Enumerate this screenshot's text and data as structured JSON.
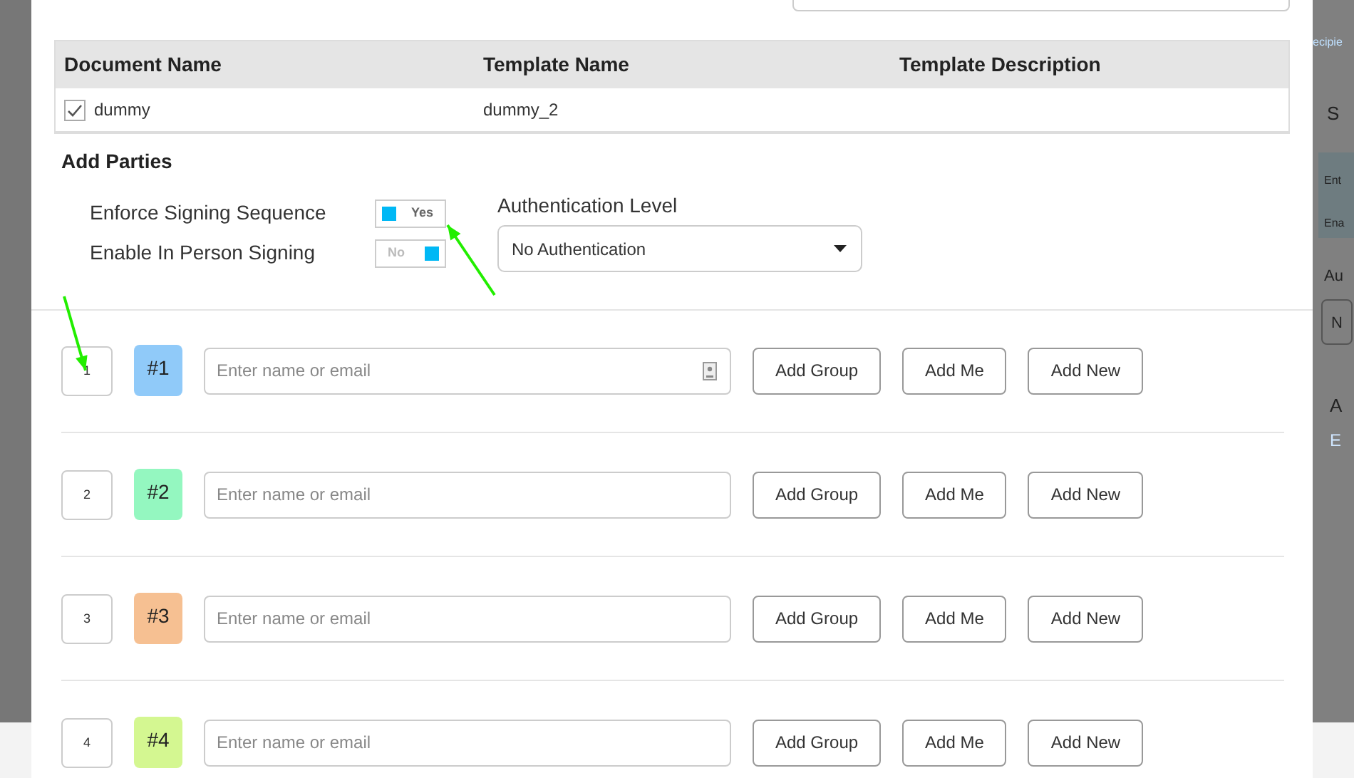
{
  "documents_table": {
    "columns": [
      "Document Name",
      "Template Name",
      "Template Description"
    ],
    "rows": [
      {
        "checked": true,
        "cells": [
          "dummy",
          "dummy_2",
          null
        ]
      }
    ]
  },
  "add_parties": {
    "title": "Add Parties",
    "toggles": [
      {
        "label": "Enforce Signing Sequence",
        "on": true,
        "text": "Yes"
      },
      {
        "label": "Enable In Person Signing",
        "on": false,
        "text": "No"
      }
    ],
    "authentication": {
      "label": "Authentication Level",
      "value": "No Authentication"
    }
  },
  "parties": [
    {
      "order": "1",
      "tag": "#1",
      "color": "#90caf9",
      "placeholder": "Enter name or email",
      "contact_icon": true,
      "buttons": [
        "Add Group",
        "Add Me",
        "Add New"
      ]
    },
    {
      "order": "2",
      "tag": "#2",
      "color": "#94f7c0",
      "placeholder": "Enter name or email",
      "contact_icon": false,
      "buttons": [
        "Add Group",
        "Add Me",
        "Add New"
      ]
    },
    {
      "order": "3",
      "tag": "#3",
      "color": "#f6c092",
      "placeholder": "Enter name or email",
      "contact_icon": false,
      "buttons": [
        "Add Group",
        "Add Me",
        "Add New"
      ]
    },
    {
      "order": "4",
      "tag": "#4",
      "color": "#d4f791",
      "placeholder": "Enter name or email",
      "contact_icon": false,
      "buttons": [
        "Add Group",
        "Add Me",
        "Add New"
      ]
    }
  ],
  "background_page": {
    "link": "ecipie",
    "step": "S",
    "panel_lines": [
      "Ent",
      "Ena"
    ],
    "label": "Au",
    "field": "N",
    "heading": "A",
    "sub": "E"
  }
}
